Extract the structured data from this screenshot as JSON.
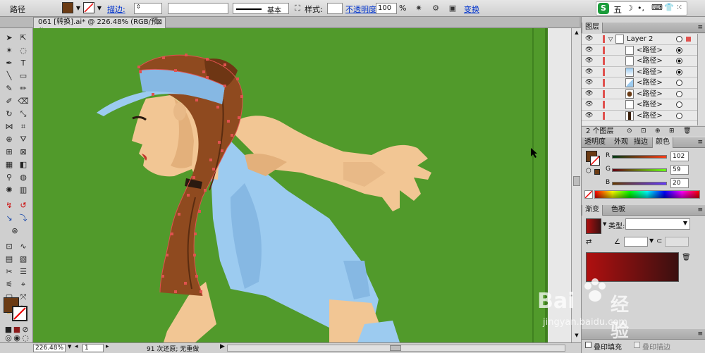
{
  "control_bar": {
    "object_type": "路径",
    "stroke_label": "描边:",
    "stroke_style": "基本",
    "style_label": "样式:",
    "opacity_label": "不透明度:",
    "opacity_value": "100",
    "opacity_unit": "%",
    "transform_label": "变换"
  },
  "ime": {
    "mode_text": "五"
  },
  "document": {
    "tab_title": "061 [转换].ai* @ 226.48% (RGB/预览)"
  },
  "status_bar": {
    "zoom": "226.48%",
    "artboard": "1",
    "message": "91 次还原; 无重做"
  },
  "layers_panel": {
    "title": "图层",
    "layer_name": "Layer 2",
    "items": [
      {
        "label": "<路径>",
        "target": "filled"
      },
      {
        "label": "<路径>",
        "target": "filled"
      },
      {
        "label": "<路径>",
        "target": "filled"
      },
      {
        "label": "<路径>",
        "target": "empty"
      },
      {
        "label": "<路径>",
        "target": "empty"
      },
      {
        "label": "<路径>",
        "target": "empty"
      },
      {
        "label": "<路径>",
        "target": "empty"
      }
    ],
    "footer_count": "2 个图层"
  },
  "color_panel": {
    "tabs": [
      "透明度",
      "外观",
      "描边",
      "颜色"
    ],
    "r_label": "R",
    "r_value": "102",
    "g_label": "G",
    "g_value": "59",
    "b_label": "B",
    "b_value": "20"
  },
  "gradient_panel": {
    "tabs": [
      "渐变",
      "色板"
    ],
    "type_label": "类型:"
  },
  "bottom_panel": {
    "overprint_fill": "叠印填充",
    "overprint_stroke": "叠印描边"
  },
  "watermark": {
    "brand": "Bai",
    "brand_cn": "经验",
    "url": "jingyan.baidu.com"
  },
  "colors": {
    "fill": "#6b3b14",
    "canvas_green": "#519a2b",
    "shirt": "#9ccbf0",
    "skin": "#f2c694",
    "hair": "#8f4a1f",
    "anchor": "#e0524f"
  }
}
